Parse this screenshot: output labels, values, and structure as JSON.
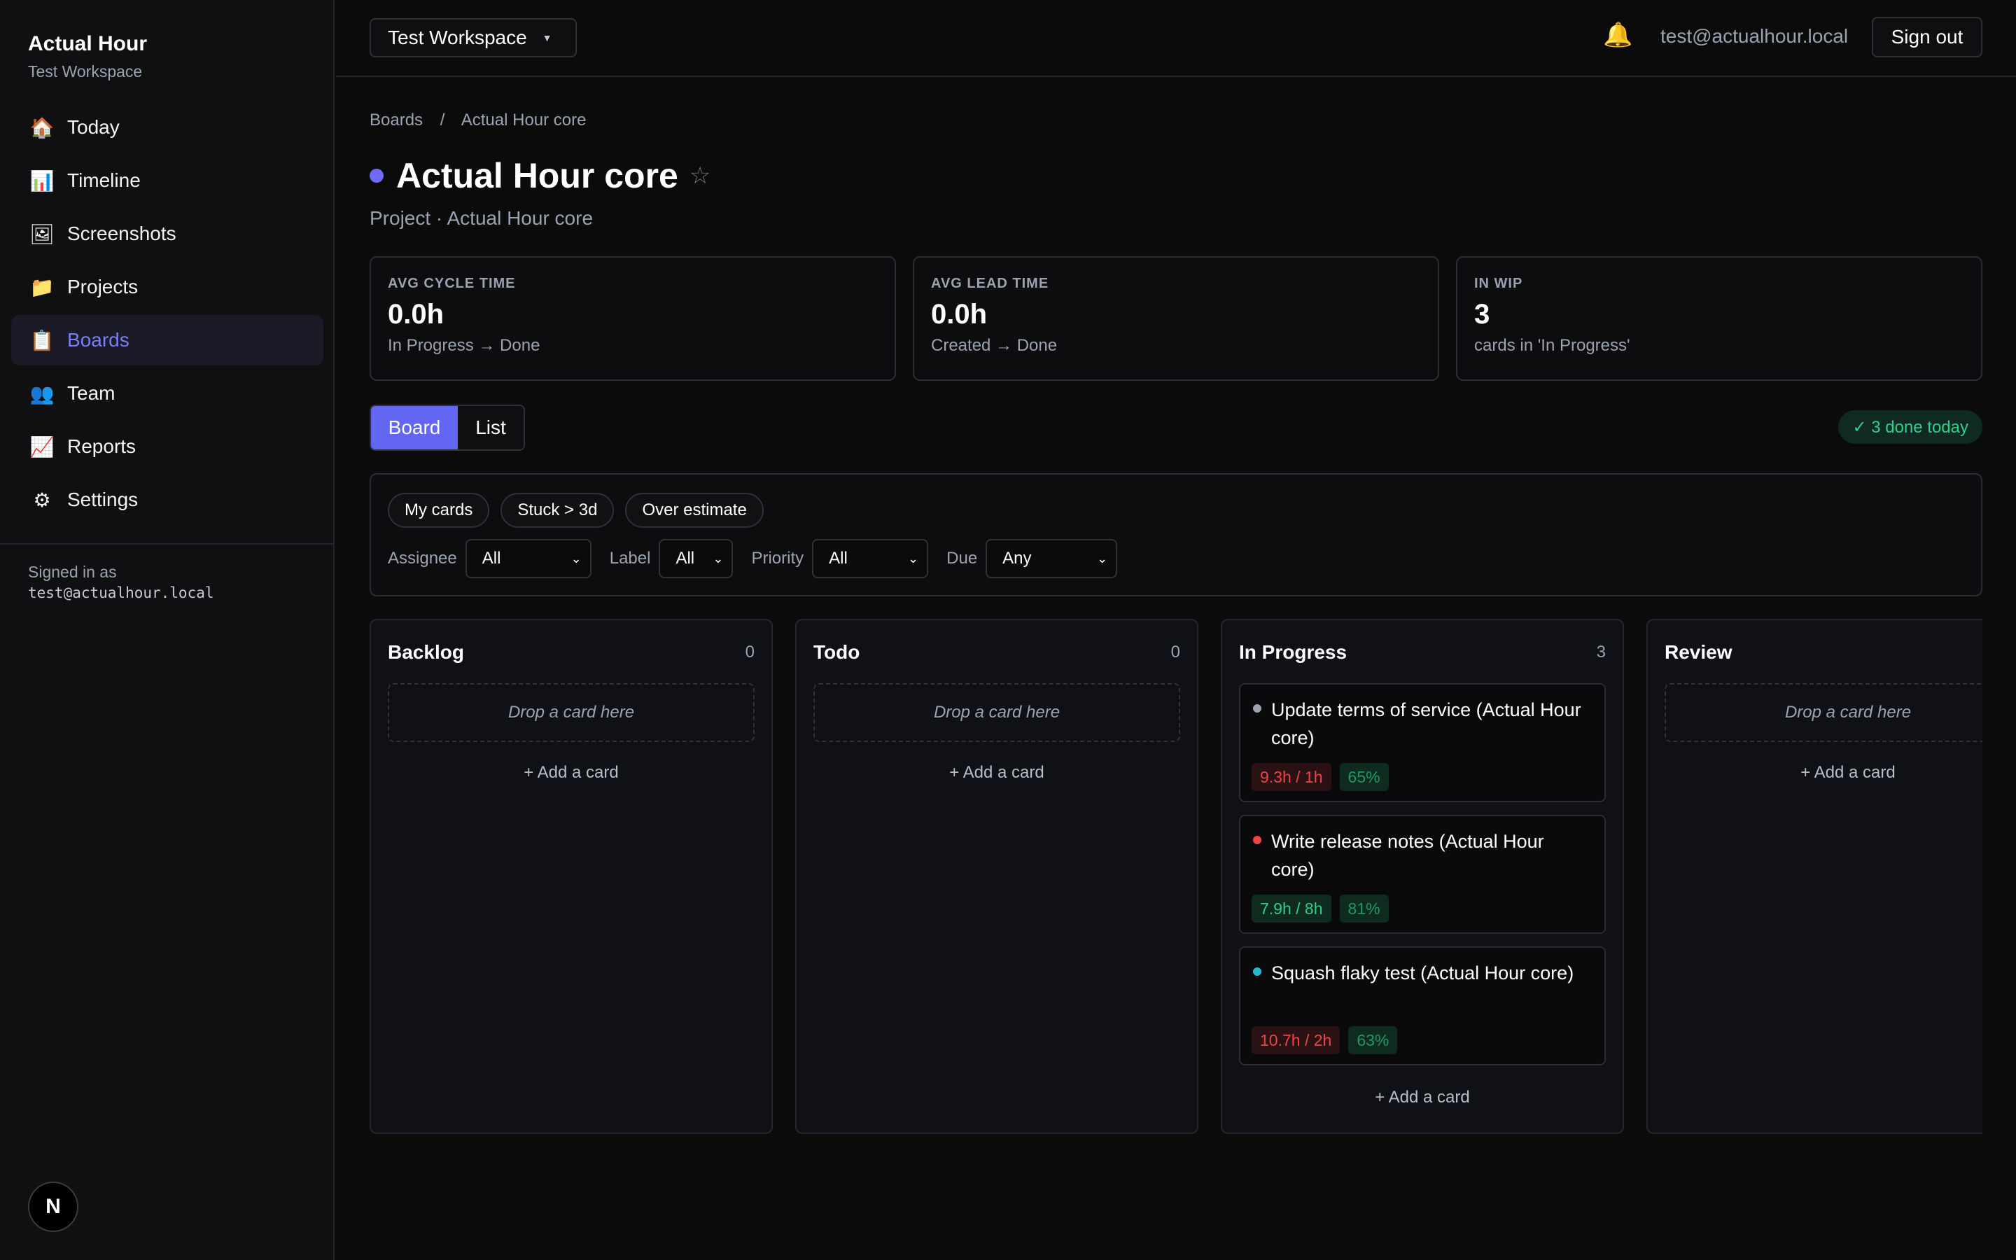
{
  "sidebar": {
    "brand_title": "Actual Hour",
    "brand_sub": "Test Workspace",
    "items": [
      {
        "label": "Today",
        "icon": "🏠"
      },
      {
        "label": "Timeline",
        "icon": "📊"
      },
      {
        "label": "Screenshots",
        "icon": "🖼"
      },
      {
        "label": "Projects",
        "icon": "📁"
      },
      {
        "label": "Boards",
        "icon": "📋"
      },
      {
        "label": "Team",
        "icon": "👥"
      },
      {
        "label": "Reports",
        "icon": "📈"
      },
      {
        "label": "Settings",
        "icon": "⚙"
      }
    ],
    "signed_in_label": "Signed in as",
    "signed_in_email": "test@actualhour.local",
    "badge": "N"
  },
  "topbar": {
    "workspace": "Test Workspace",
    "workspace_caret": "▼",
    "bell_icon": "🔔",
    "email": "test@actualhour.local",
    "signout": "Sign out"
  },
  "breadcrumb": {
    "root": "Boards",
    "sep": "/",
    "current": "Actual Hour core"
  },
  "page": {
    "title": "Actual Hour core",
    "star": "☆",
    "subtitle": "Project · Actual Hour core",
    "accent": "#6d6af5"
  },
  "stats": [
    {
      "label": "AVG CYCLE TIME",
      "value": "0.0h",
      "sub": "In Progress → Done"
    },
    {
      "label": "AVG LEAD TIME",
      "value": "0.0h",
      "sub": "Created → Done"
    },
    {
      "label": "IN WIP",
      "value": "3",
      "sub": "cards in 'In Progress'"
    }
  ],
  "view": {
    "board": "Board",
    "list": "List",
    "done_today": "✓ 3 done today"
  },
  "filters": {
    "chips": [
      "My cards",
      "Stuck > 3d",
      "Over estimate"
    ],
    "assignee_label": "Assignee",
    "assignee_value": "All",
    "label_label": "Label",
    "label_value": "All",
    "priority_label": "Priority",
    "priority_value": "All",
    "due_label": "Due",
    "due_value": "Any",
    "chevron": "⌄"
  },
  "board": {
    "drop_text": "Drop a card here",
    "add_text": "+ Add a card",
    "columns": [
      {
        "title": "Backlog",
        "count": "0"
      },
      {
        "title": "Todo",
        "count": "0"
      },
      {
        "title": "In Progress",
        "count": "3"
      },
      {
        "title": "Review",
        "count": ""
      }
    ],
    "cards": [
      {
        "title": "Update terms of service (Actual Hour core)",
        "time": "9.3h / 1h",
        "pct": "65%",
        "dot": "#9ca3af"
      },
      {
        "title": "Write release notes (Actual Hour core)",
        "time": "7.9h / 8h",
        "pct": "81%",
        "dot": "#ef4444"
      },
      {
        "title": "Squash flaky test (Actual Hour core)",
        "time": "10.7h / 2h",
        "pct": "63%",
        "dot": "#22b8cf"
      }
    ]
  }
}
